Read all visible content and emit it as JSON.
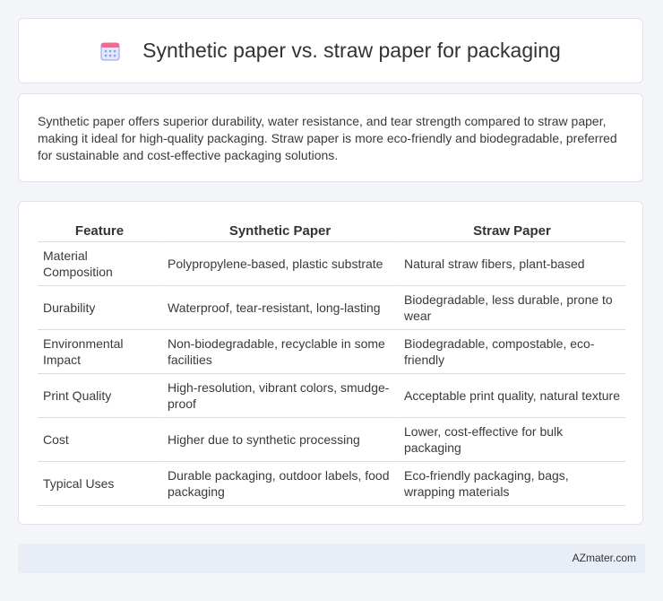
{
  "header": {
    "title": "Synthetic paper vs. straw paper for packaging",
    "icon": "calendar-icon"
  },
  "summary": {
    "text": "Synthetic paper offers superior durability, water resistance, and tear strength compared to straw paper, making it ideal for high-quality packaging. Straw paper is more eco-friendly and biodegradable, preferred for sustainable and cost-effective packaging solutions."
  },
  "table": {
    "headers": [
      "Feature",
      "Synthetic Paper",
      "Straw Paper"
    ],
    "rows": [
      [
        "Material Composition",
        "Polypropylene-based, plastic substrate",
        "Natural straw fibers, plant-based"
      ],
      [
        "Durability",
        "Waterproof, tear-resistant, long-lasting",
        "Biodegradable, less durable, prone to wear"
      ],
      [
        "Environmental Impact",
        "Non-biodegradable, recyclable in some facilities",
        "Biodegradable, compostable, eco-friendly"
      ],
      [
        "Print Quality",
        "High-resolution, vibrant colors, smudge-proof",
        "Acceptable print quality, natural texture"
      ],
      [
        "Cost",
        "Higher due to synthetic processing",
        "Lower, cost-effective for bulk packaging"
      ],
      [
        "Typical Uses",
        "Durable packaging, outdoor labels, food packaging",
        "Eco-friendly packaging, bags, wrapping materials"
      ]
    ]
  },
  "footer": {
    "brand": "AZmater.com"
  },
  "colors": {
    "icon_top": "#e96a8f",
    "icon_body": "#7b8ff0",
    "background": "#f4f5f9",
    "footer_bg": "#e8edf6"
  }
}
